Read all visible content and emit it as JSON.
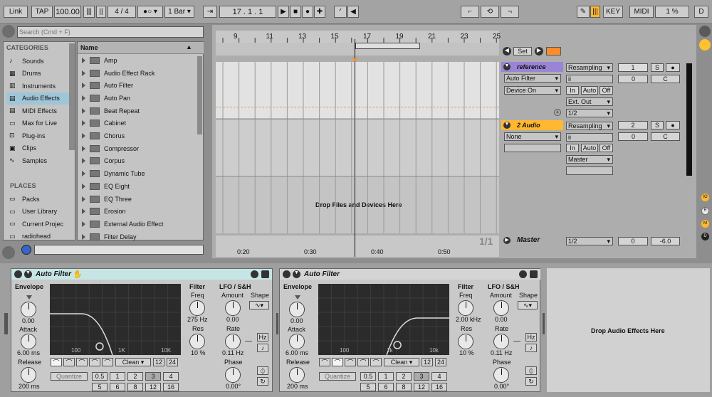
{
  "transport": {
    "link": "Link",
    "tap": "TAP",
    "tempo": "100.00",
    "sig_num": "4",
    "sig_den": "4",
    "quant": "1 Bar",
    "position": "17 .   1 .   1",
    "key": "KEY",
    "midi": "MIDI",
    "cpu": "1 %",
    "d": "D"
  },
  "browser": {
    "search_placeholder": "Search (Cmd + F)",
    "categories_title": "CATEGORIES",
    "categories": [
      "Sounds",
      "Drums",
      "Instruments",
      "Audio Effects",
      "MIDI Effects",
      "Max for Live",
      "Plug-ins",
      "Clips",
      "Samples"
    ],
    "places_title": "PLACES",
    "places": [
      "Packs",
      "User Library",
      "Current Projec",
      "radiohead"
    ],
    "list_header": "Name",
    "items": [
      "Amp",
      "Audio Effect Rack",
      "Auto Filter",
      "Auto Pan",
      "Beat Repeat",
      "Cabinet",
      "Chorus",
      "Compressor",
      "Corpus",
      "Dynamic Tube",
      "EQ Eight",
      "EQ Three",
      "Erosion",
      "External Audio Effect",
      "Filter Delay"
    ]
  },
  "arrangement": {
    "bars": [
      "9",
      "11",
      "13",
      "15",
      "17",
      "19",
      "21",
      "23",
      "25"
    ],
    "times": [
      "0:20",
      "0:30",
      "0:40",
      "0:50"
    ],
    "drop_text": "Drop Files and Devices Here",
    "set": "Set",
    "page": "1/1"
  },
  "tracks": {
    "t1": {
      "name": "reference",
      "input": "Resampling",
      "fx": "Auto Filter",
      "chain": "Device On",
      "in": "In",
      "auto": "Auto",
      "off": "Off",
      "out": "Ext. Out",
      "out2": "1/2",
      "num": "1",
      "s": "S",
      "vol": "0",
      "pan": "C"
    },
    "t2": {
      "name": "2 Audio",
      "input": "Resampling",
      "none": "None",
      "in": "In",
      "auto": "Auto",
      "off": "Off",
      "out": "Master",
      "num": "2",
      "s": "S",
      "vol": "0",
      "pan": "C"
    },
    "master": {
      "name": "Master",
      "out": "1/2",
      "vol": "0",
      "vol2": "-6.0"
    }
  },
  "right_icons": [
    "IO",
    "R",
    "M",
    "D"
  ],
  "devices": [
    {
      "title": "Auto Filter",
      "envelope": "Envelope",
      "env_val": "0.00",
      "attack": "Attack",
      "attack_val": "6.00 ms",
      "release": "Release",
      "release_val": "200 ms",
      "filter": "Filter",
      "freq": "Freq",
      "freq_val": "275 Hz",
      "res": "Res",
      "res_val": "10 %",
      "lfo": "LFO / S&H",
      "amount": "Amount",
      "amount_val": "0.00",
      "shape": "Shape",
      "rate": "Rate",
      "rate_val": "0.11 Hz",
      "phase": "Phase",
      "phase_val": "0.00°",
      "hz": "Hz",
      "g100": "100",
      "g1k": "1K",
      "g10k": "10K",
      "clean": "Clean",
      "b12": "12",
      "b24": "24",
      "quantize": "Quantize",
      "q": [
        "0.5",
        "1",
        "2",
        "3",
        "4",
        "5",
        "6",
        "8",
        "12",
        "16"
      ],
      "cut": 0.38
    },
    {
      "title": "Auto Filter",
      "envelope": "Envelope",
      "env_val": "0.00",
      "attack": "Attack",
      "attack_val": "6.00 ms",
      "release": "Release",
      "release_val": "200 ms",
      "filter": "Filter",
      "freq": "Freq",
      "freq_val": "2.00 kHz",
      "res": "Res",
      "res_val": "10 %",
      "lfo": "LFO / S&H",
      "amount": "Amount",
      "amount_val": "0.00",
      "shape": "Shape",
      "rate": "Rate",
      "rate_val": "0.11 Hz",
      "phase": "Phase",
      "phase_val": "0.00°",
      "hz": "Hz",
      "g100": "100",
      "g1k": "1k",
      "g10k": "10k",
      "clean": "Clean",
      "b12": "12",
      "b24": "24",
      "quantize": "Quantize",
      "q": [
        "0.5",
        "1",
        "2",
        "3",
        "4",
        "5",
        "6",
        "8",
        "12",
        "16"
      ],
      "cut": 0.62
    }
  ],
  "drop_effects": "Drop Audio Effects Here"
}
